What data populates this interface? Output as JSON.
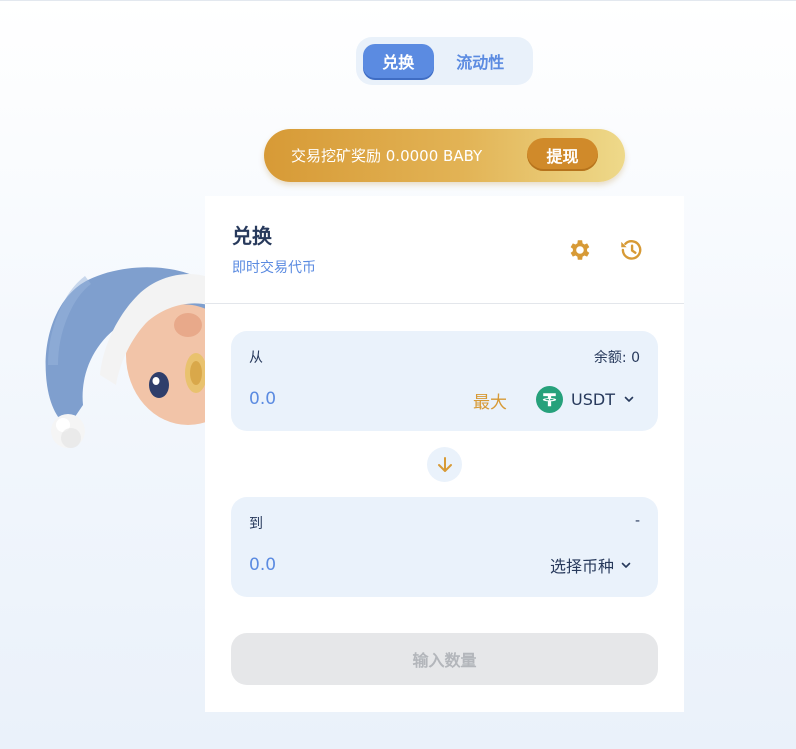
{
  "tabs": [
    {
      "label": "兑换",
      "active": true
    },
    {
      "label": "流动性",
      "active": false
    }
  ],
  "reward": {
    "text": "交易挖矿奖励 0.0000 BABY",
    "button_label": "提现"
  },
  "card": {
    "title": "兑换",
    "subtitle": "即时交易代币",
    "icons": {
      "settings": "gear-icon",
      "history": "history-icon"
    }
  },
  "from": {
    "label": "从",
    "balance": "余额: 0",
    "amount": "0.0",
    "max_label": "最大",
    "token": "USDT"
  },
  "to": {
    "label": "到",
    "balance": "-",
    "amount": "0.0",
    "select_label": "选择币种"
  },
  "submit_label": "输入数量",
  "colors": {
    "accent_blue": "#5b8be1",
    "gold": "#d79a36",
    "usdt_green": "#26a17b",
    "text_dark": "#283a5c"
  }
}
